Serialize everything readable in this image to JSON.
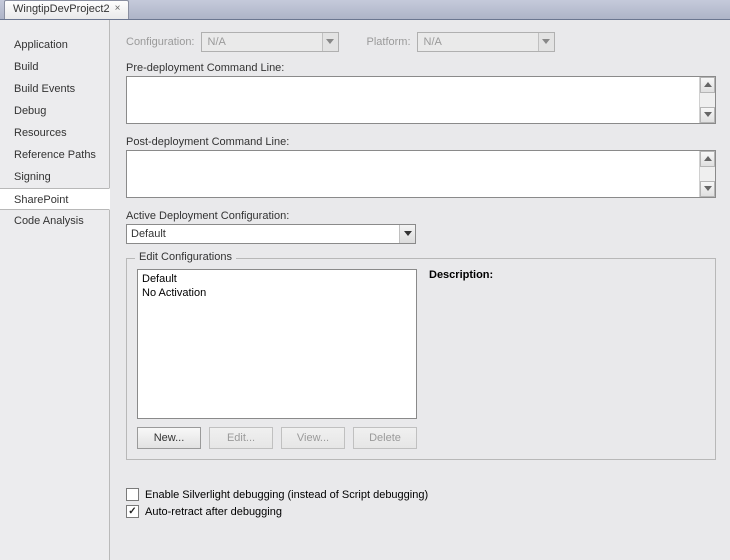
{
  "tab": {
    "title": "WingtipDevProject2"
  },
  "sidebar": {
    "items": [
      {
        "label": "Application"
      },
      {
        "label": "Build"
      },
      {
        "label": "Build Events"
      },
      {
        "label": "Debug"
      },
      {
        "label": "Resources"
      },
      {
        "label": "Reference Paths"
      },
      {
        "label": "Signing"
      },
      {
        "label": "SharePoint"
      },
      {
        "label": "Code Analysis"
      }
    ],
    "selected": "SharePoint"
  },
  "header": {
    "configuration_label": "Configuration:",
    "configuration_value": "N/A",
    "platform_label": "Platform:",
    "platform_value": "N/A"
  },
  "pre_deploy": {
    "label": "Pre-deployment Command Line:",
    "value": ""
  },
  "post_deploy": {
    "label": "Post-deployment Command Line:",
    "value": ""
  },
  "active_config": {
    "label": "Active Deployment Configuration:",
    "value": "Default"
  },
  "edit_configs": {
    "group_title": "Edit Configurations",
    "items": [
      "Default",
      "No Activation"
    ],
    "description_label": "Description:",
    "buttons": {
      "new": "New...",
      "edit": "Edit...",
      "view": "View...",
      "delete": "Delete"
    }
  },
  "checks": {
    "silverlight": {
      "label": "Enable Silverlight debugging (instead of Script debugging)",
      "checked": false
    },
    "autoretract": {
      "label": "Auto-retract after debugging",
      "checked": true
    }
  }
}
